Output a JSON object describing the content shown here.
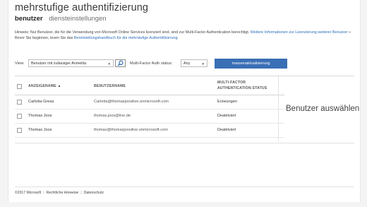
{
  "page": {
    "title": "mehrstufige authentifizierung",
    "tabs": [
      {
        "label": "benutzer",
        "active": true
      },
      {
        "label": "diensteinstellungen",
        "active": false
      }
    ]
  },
  "notice": {
    "line1": "Hinweis: Nur Benutzer, die für die Verwendung von Microsoft Online Services lizenziert sind, sind zur Multi-Factor Authentication berechtigt.",
    "line1_link": "Weitere Informationen zur Lizenzierung weiterer Benutzer",
    "line1_suffix": "»",
    "line2": "Bevor Sie beginnen, lesen Sie das",
    "line2_link": "Bereitstellungshandbuch für die mehrstufige Authentifizierung",
    "line2_suffix": "."
  },
  "filters": {
    "view_label": "View:",
    "view_value": "Benutzer mit zulässiger Anmeldu",
    "status_label": "Multi-Factor Auth status:",
    "status_value": "Any",
    "bulk_update_label": "massenaktualisierung",
    "search_icon": "search-icon"
  },
  "table": {
    "headers": {
      "display_name": "ANZEIGENAME ▲",
      "user_name": "BENUTZERNAME",
      "mfa_status": [
        "MULTI-FACTOR",
        "AUTHENTICATION-STATUS"
      ]
    },
    "rows": [
      {
        "display_name": "Carlotta Greas",
        "user_name": "Carlotta@thomasjoosilive.onmicrosoft.com",
        "status": "Erzwungen"
      },
      {
        "display_name": "Thomas Joos",
        "user_name": "thomas.joos@live.de",
        "status": "Deaktiviert"
      },
      {
        "display_name": "Thomas Joos",
        "user_name": "thomas@thomasjoosilive.onmicrosoft.com",
        "status": "Deaktiviert"
      }
    ]
  },
  "detail": {
    "title": "Benutzer auswählen"
  },
  "footer": {
    "copyright": "©2017 Microsoft",
    "legal": "Rechtliche Hinweise",
    "privacy": "Datenschutz"
  },
  "colors": {
    "accent": "#3a6fb5",
    "link": "#2b6cb8",
    "background": "#f4f4f4"
  }
}
